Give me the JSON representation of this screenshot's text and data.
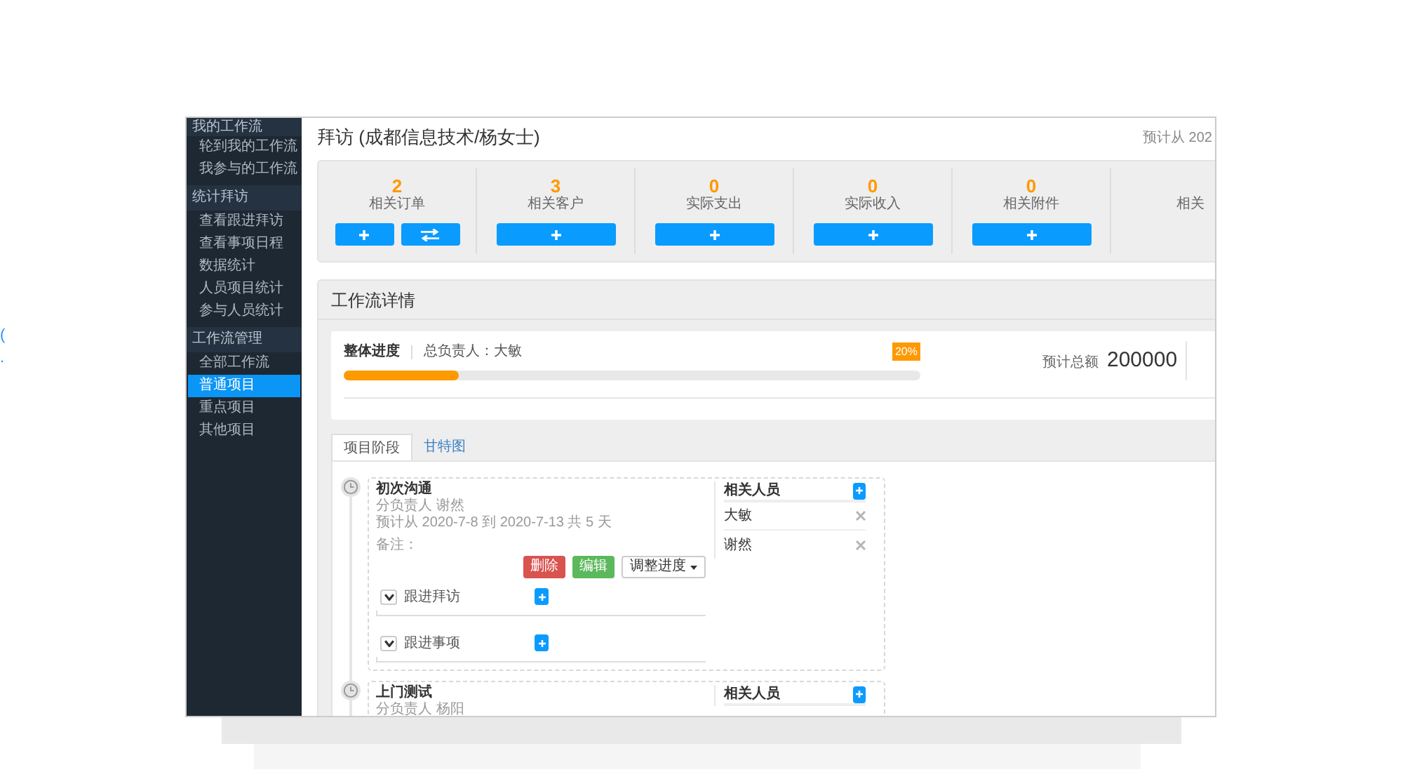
{
  "edge_fragments": [
    "(",
    "."
  ],
  "sidebar": {
    "groups": [
      {
        "title": "我的工作流",
        "items": [
          {
            "label": "轮到我的工作流",
            "selected": false
          },
          {
            "label": "我参与的工作流",
            "selected": false
          }
        ]
      },
      {
        "title": "统计拜访",
        "items": [
          {
            "label": "查看跟进拜访",
            "selected": false
          },
          {
            "label": "查看事项日程",
            "selected": false
          },
          {
            "label": "数据统计",
            "selected": false
          },
          {
            "label": "人员项目统计",
            "selected": false
          },
          {
            "label": "参与人员统计",
            "selected": false
          }
        ]
      },
      {
        "title": "工作流管理",
        "items": [
          {
            "label": "全部工作流",
            "selected": false
          },
          {
            "label": "普通项目",
            "selected": true
          },
          {
            "label": "重点项目",
            "selected": false
          },
          {
            "label": "其他项目",
            "selected": false
          }
        ]
      }
    ]
  },
  "header": {
    "title": "拜访 (成都信息技术/杨女士)",
    "schedule": "预计从 202"
  },
  "stats": [
    {
      "value": "2",
      "label": "相关订单",
      "actions": [
        {
          "kind": "add"
        },
        {
          "kind": "swap"
        }
      ]
    },
    {
      "value": "3",
      "label": "相关客户",
      "actions": [
        {
          "kind": "add"
        }
      ]
    },
    {
      "value": "0",
      "label": "实际支出",
      "actions": [
        {
          "kind": "add"
        }
      ]
    },
    {
      "value": "0",
      "label": "实际收入",
      "actions": [
        {
          "kind": "add"
        }
      ]
    },
    {
      "value": "0",
      "label": "相关附件",
      "actions": [
        {
          "kind": "add"
        }
      ]
    },
    {
      "label": "相关"
    }
  ],
  "workflow_detail": {
    "title": "工作流详情",
    "progress": {
      "label": "整体进度",
      "owner": "总负责人：大敏",
      "level": 0.2,
      "percent": "20%"
    },
    "total": {
      "label": "预计总额",
      "value": "200000"
    }
  },
  "tabs": [
    {
      "label": "项目阶段",
      "selected": true
    },
    {
      "label": "甘特图",
      "selected": false
    }
  ],
  "phases": [
    {
      "title": "初次沟通",
      "owner": "分负责人 谢然",
      "schedule": "预计从 2020-7-8 到 2020-7-13 共 5 天",
      "note": "备注：",
      "actions": [
        {
          "kind": "danger",
          "label": "删除"
        },
        {
          "kind": "success",
          "label": "编辑"
        },
        {
          "kind": "dropdown",
          "label": "调整进度"
        }
      ],
      "sections": [
        "跟进拜访",
        "跟进事项"
      ],
      "people": {
        "title": "相关人员",
        "members": [
          "大敏",
          "谢然"
        ]
      }
    },
    {
      "title": "上门测试",
      "owner": "分负责人 杨阳",
      "people": {
        "title": "相关人员"
      }
    }
  ]
}
